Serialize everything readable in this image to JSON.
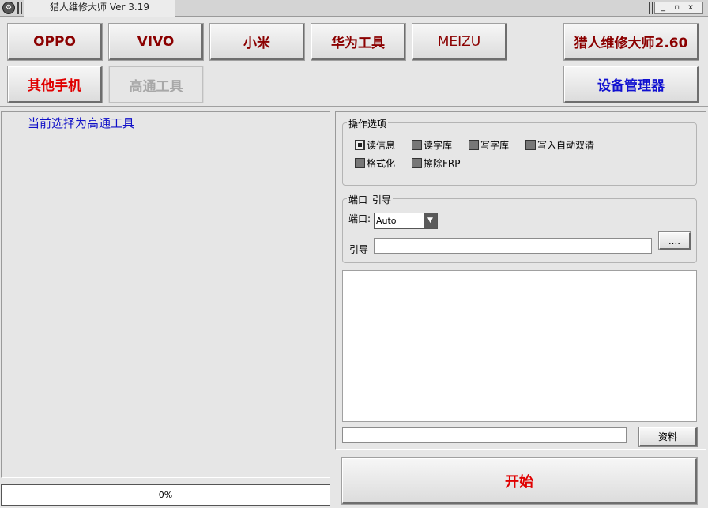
{
  "window": {
    "title": "猎人维修大师 Ver 3.19",
    "icon_glyph": "⚙",
    "controls": "_ ▫ x"
  },
  "brand_buttons": {
    "oppo": "OPPO",
    "vivo": "VIVO",
    "xiaomi": "小米",
    "huawei": "华为工具",
    "meizu": "MEIZU",
    "other": "其他手机",
    "qualcomm": "高通工具",
    "master": "猎人维修大师2.60",
    "device_manager": "设备管理器"
  },
  "status": {
    "current_selection": "当前选择为高通工具",
    "progress_text": "0%",
    "progress": 0
  },
  "options": {
    "group_title": "操作选项",
    "items": [
      {
        "label": "读信息",
        "checked": true
      },
      {
        "label": "读字库",
        "checked": false
      },
      {
        "label": "写字库",
        "checked": false
      },
      {
        "label": "写入自动双清",
        "checked": false
      },
      {
        "label": "格式化",
        "checked": false
      },
      {
        "label": "擦除FRP",
        "checked": false
      }
    ]
  },
  "port": {
    "group_title": "端口_引导",
    "port_label": "端口:",
    "port_value": "Auto",
    "loader_label": "引导",
    "loader_value": "",
    "browse_label": "...."
  },
  "bottom": {
    "info_value": "",
    "info_button": "资料",
    "start_button": "开始"
  }
}
